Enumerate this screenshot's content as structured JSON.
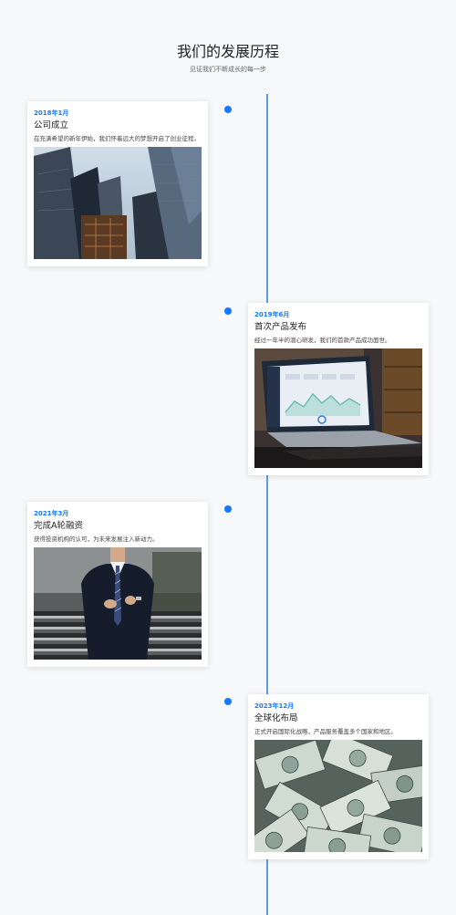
{
  "header": {
    "title": "我们的发展历程",
    "subtitle": "见证我们不断成长的每一步"
  },
  "events": [
    {
      "date": "2018年1月",
      "title": "公司成立",
      "description": "在充满希望的新年伊始，我们怀着远大的梦想开启了创业征程。",
      "image": "city-skyscrapers-photo"
    },
    {
      "date": "2019年6月",
      "title": "首次产品发布",
      "description": "经过一年半的潜心研发，我们的首款产品成功面世。",
      "image": "laptop-dashboard-photo"
    },
    {
      "date": "2021年3月",
      "title": "完成A轮融资",
      "description": "获得投资机构的认可，为未来发展注入新动力。",
      "image": "businessman-suit-photo"
    },
    {
      "date": "2023年12月",
      "title": "全球化布局",
      "description": "正式开启国际化战略，产品服务覆盖多个国家和地区。",
      "image": "dollar-bills-photo"
    }
  ],
  "colors": {
    "accent": "#1677ff",
    "timeline": "#5a9bf0",
    "background": "#f7f8fa"
  }
}
